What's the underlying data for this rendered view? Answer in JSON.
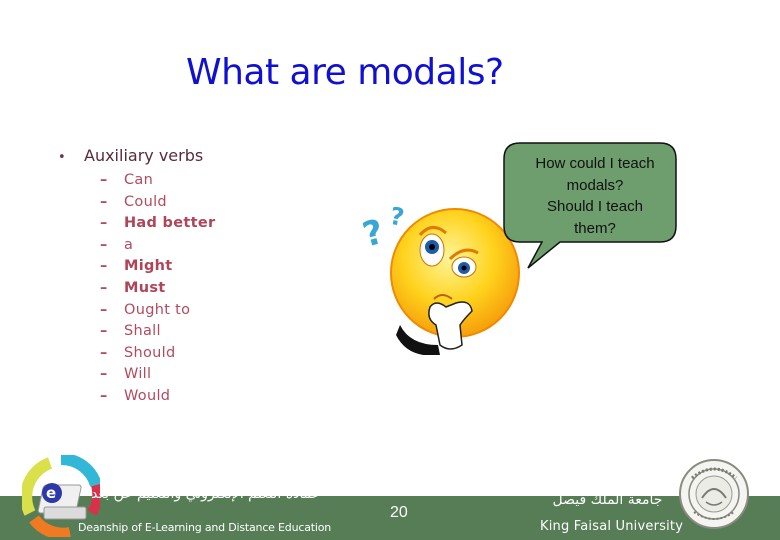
{
  "slide": {
    "title": "What are modals?",
    "bullet": {
      "label": "Auxiliary verbs",
      "marker": "•",
      "items": [
        {
          "text": "Can",
          "bold": false
        },
        {
          "text": "Could",
          "bold": false
        },
        {
          "text": "Had better",
          "bold": true
        },
        {
          "text": "a",
          "bold": false
        },
        {
          "text": "Might",
          "bold": true
        },
        {
          "text": "Must",
          "bold": true
        },
        {
          "text": "Ought to",
          "bold": false
        },
        {
          "text": "Shall",
          "bold": false
        },
        {
          "text": "Should",
          "bold": false
        },
        {
          "text": "Will",
          "bold": false
        },
        {
          "text": "Would",
          "bold": false
        }
      ],
      "sub_marker": "–"
    },
    "speech_bubble": {
      "lines": [
        "How could I teach",
        "modals?",
        "Should I teach",
        "them?"
      ]
    },
    "image": {
      "icon": "thinking-face-icon"
    },
    "colors": {
      "title": "#1010d0",
      "bullet": "#5a2a3a",
      "sub_items": "#b14b5f",
      "bubble_fill": "#6e9e6e",
      "footer_bar": "#567d56"
    }
  },
  "footer": {
    "deanship_ar": "عمادة التعلم الإلكتروني والتعليم عن بعد",
    "deanship_en": "Deanship of E-Learning and Distance Education",
    "page_number": "20",
    "university_ar": "جامعة الملك فيصل",
    "university_en": "King Faisal University",
    "left_logo": "e-learning-logo-icon",
    "right_logo": "university-seal-icon"
  }
}
